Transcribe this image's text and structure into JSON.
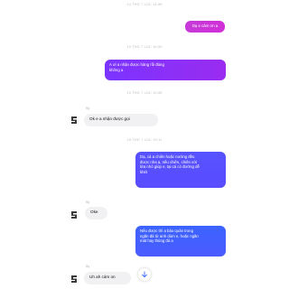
{
  "colors": {
    "outgoing_gradient_start": "#7b34ff",
    "outgoing_gradient_end": "#d025d8",
    "outgoing_blue_start": "#3b63ff",
    "outgoing_blue_end": "#6447ff",
    "incoming_bg": "#f1f0f2",
    "timestamp": "#b9bcc2"
  },
  "messages": {
    "ts1": "14 THG 7 LÚC 14:55",
    "m1": "Dạ e cảm ơn a",
    "ts2": "15 THG 7 LÚC 16:50",
    "m2_l1": "A ơi a nhận được hàng rồi đúng",
    "m2_l2": "không a",
    "ts3": "15 THG 7 LÚC 16:55",
    "sender1": "Sy",
    "m3": "Ok e a nhận được gọi",
    "ts4": "15 THG 7 LÚC 19:11",
    "m4_l1": "Dạ, cá a chiên hoặc nướng đều",
    "m4_l2": "được nha a, nếu chiên, chiên với",
    "m4_l3": "lửa nhỏ giúp e, tại cá có đường dễ",
    "m4_l4": "khét",
    "sender2": "Sy",
    "m5": "Oke",
    "m6_l1": "Nếu được thì a bảo quản trong",
    "m6_l2": "ngăn đá từ anh dùm e, hoặc ngăn",
    "m6_l3": "mát hay thùng đá a",
    "sender3": "Sy",
    "m7": "Uh ah cám on"
  },
  "icons": {
    "avatar": "avatar-icon",
    "scroll_down": "arrow-down-icon"
  }
}
